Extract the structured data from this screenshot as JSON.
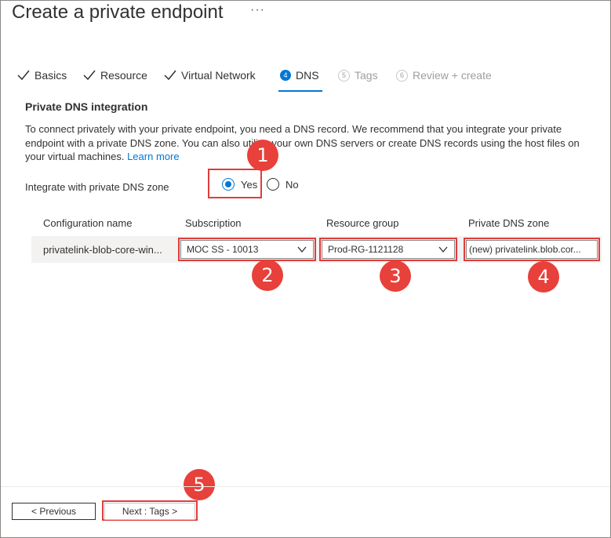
{
  "page": {
    "title": "Create a private endpoint",
    "more": "···"
  },
  "tabs": [
    {
      "label": "Basics",
      "state": "done"
    },
    {
      "label": "Resource",
      "state": "done"
    },
    {
      "label": "Virtual Network",
      "state": "done"
    },
    {
      "label": "DNS",
      "state": "active",
      "step": "4"
    },
    {
      "label": "Tags",
      "state": "disabled",
      "step": "5"
    },
    {
      "label": "Review + create",
      "state": "disabled",
      "step": "6"
    }
  ],
  "dns": {
    "section_title": "Private DNS integration",
    "description": "To connect privately with your private endpoint, you need a DNS record. We recommend that you integrate your private endpoint with a private DNS zone. You can also utilize your own DNS servers or create DNS records using the host files on your virtual machines.",
    "learn_more": "Learn more",
    "integrate_label": "Integrate with private DNS zone",
    "yes_label": "Yes",
    "no_label": "No",
    "selected": "Yes"
  },
  "table": {
    "headers": [
      "Configuration name",
      "Subscription",
      "Resource group",
      "Private DNS zone"
    ],
    "row": {
      "config_name": "privatelink-blob-core-win...",
      "subscription": "MOC SS - 10013",
      "resource_group": "Prod-RG-1121128",
      "dns_zone": "(new) privatelink.blob.cor..."
    }
  },
  "annotations": [
    "1",
    "2",
    "3",
    "4",
    "5"
  ],
  "footer": {
    "previous": "< Previous",
    "next": "Next : Tags >"
  },
  "colors": {
    "accent": "#0078d4",
    "highlight": "#e03c3c"
  }
}
